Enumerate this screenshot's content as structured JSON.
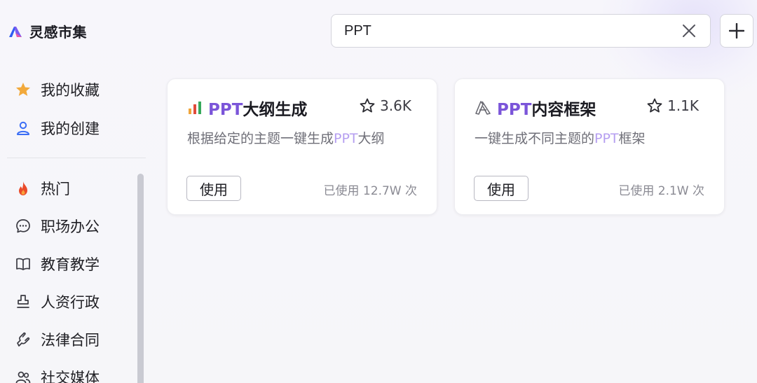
{
  "brand": {
    "name": "灵感市集"
  },
  "search": {
    "value": "PPT"
  },
  "sidebar": {
    "top_items": [
      {
        "label": "我的收藏",
        "icon": "star-icon"
      },
      {
        "label": "我的创建",
        "icon": "user-icon"
      }
    ],
    "categories": [
      {
        "label": "热门",
        "icon": "fire-icon"
      },
      {
        "label": "职场办公",
        "icon": "chat-bubble-icon"
      },
      {
        "label": "教育教学",
        "icon": "book-icon"
      },
      {
        "label": "人资行政",
        "icon": "stamp-icon"
      },
      {
        "label": "法律合同",
        "icon": "hand-icon"
      },
      {
        "label": "社交媒体",
        "icon": "people-icon"
      }
    ]
  },
  "cards": [
    {
      "icon": "bar-chart-icon",
      "title_prefix": "PPT",
      "title_rest": "大纲生成",
      "stars": "3.6K",
      "desc_before": "根据给定的主题一键生成",
      "desc_hl": "PPT",
      "desc_after": "大纲",
      "use_label": "使用",
      "usage": "已使用 12.7W 次"
    },
    {
      "icon": "frame-icon",
      "title_prefix": "PPT",
      "title_rest": "内容框架",
      "stars": "1.1K",
      "desc_before": "一键生成不同主题的",
      "desc_hl": "PPT",
      "desc_after": "框架",
      "use_label": "使用",
      "usage": "已使用 2.1W 次"
    }
  ],
  "colors": {
    "accent": "#7b55d9",
    "accent_light": "#b59ef0",
    "star_gold": "#f2a93b",
    "user_blue": "#3b6ef5",
    "fire_red": "#ea4b2a"
  }
}
